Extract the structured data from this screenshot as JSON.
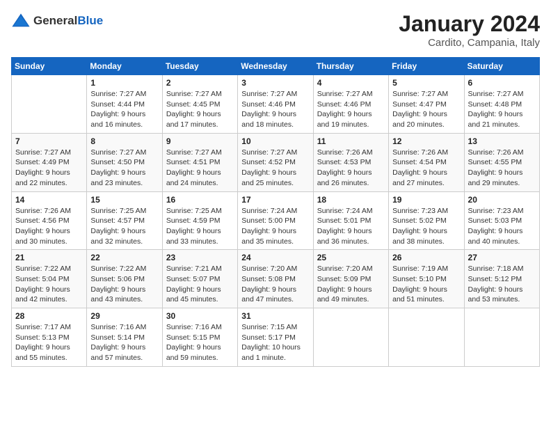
{
  "header": {
    "logo": {
      "general": "General",
      "blue": "Blue",
      "icon_alt": "GeneralBlue logo"
    },
    "title": "January 2024",
    "subtitle": "Cardito, Campania, Italy"
  },
  "days_of_week": [
    "Sunday",
    "Monday",
    "Tuesday",
    "Wednesday",
    "Thursday",
    "Friday",
    "Saturday"
  ],
  "weeks": [
    [
      {
        "date": "",
        "sunrise": "",
        "sunset": "",
        "daylight": ""
      },
      {
        "date": "1",
        "sunrise": "Sunrise: 7:27 AM",
        "sunset": "Sunset: 4:44 PM",
        "daylight": "Daylight: 9 hours and 16 minutes."
      },
      {
        "date": "2",
        "sunrise": "Sunrise: 7:27 AM",
        "sunset": "Sunset: 4:45 PM",
        "daylight": "Daylight: 9 hours and 17 minutes."
      },
      {
        "date": "3",
        "sunrise": "Sunrise: 7:27 AM",
        "sunset": "Sunset: 4:46 PM",
        "daylight": "Daylight: 9 hours and 18 minutes."
      },
      {
        "date": "4",
        "sunrise": "Sunrise: 7:27 AM",
        "sunset": "Sunset: 4:46 PM",
        "daylight": "Daylight: 9 hours and 19 minutes."
      },
      {
        "date": "5",
        "sunrise": "Sunrise: 7:27 AM",
        "sunset": "Sunset: 4:47 PM",
        "daylight": "Daylight: 9 hours and 20 minutes."
      },
      {
        "date": "6",
        "sunrise": "Sunrise: 7:27 AM",
        "sunset": "Sunset: 4:48 PM",
        "daylight": "Daylight: 9 hours and 21 minutes."
      }
    ],
    [
      {
        "date": "7",
        "sunrise": "Sunrise: 7:27 AM",
        "sunset": "Sunset: 4:49 PM",
        "daylight": "Daylight: 9 hours and 22 minutes."
      },
      {
        "date": "8",
        "sunrise": "Sunrise: 7:27 AM",
        "sunset": "Sunset: 4:50 PM",
        "daylight": "Daylight: 9 hours and 23 minutes."
      },
      {
        "date": "9",
        "sunrise": "Sunrise: 7:27 AM",
        "sunset": "Sunset: 4:51 PM",
        "daylight": "Daylight: 9 hours and 24 minutes."
      },
      {
        "date": "10",
        "sunrise": "Sunrise: 7:27 AM",
        "sunset": "Sunset: 4:52 PM",
        "daylight": "Daylight: 9 hours and 25 minutes."
      },
      {
        "date": "11",
        "sunrise": "Sunrise: 7:26 AM",
        "sunset": "Sunset: 4:53 PM",
        "daylight": "Daylight: 9 hours and 26 minutes."
      },
      {
        "date": "12",
        "sunrise": "Sunrise: 7:26 AM",
        "sunset": "Sunset: 4:54 PM",
        "daylight": "Daylight: 9 hours and 27 minutes."
      },
      {
        "date": "13",
        "sunrise": "Sunrise: 7:26 AM",
        "sunset": "Sunset: 4:55 PM",
        "daylight": "Daylight: 9 hours and 29 minutes."
      }
    ],
    [
      {
        "date": "14",
        "sunrise": "Sunrise: 7:26 AM",
        "sunset": "Sunset: 4:56 PM",
        "daylight": "Daylight: 9 hours and 30 minutes."
      },
      {
        "date": "15",
        "sunrise": "Sunrise: 7:25 AM",
        "sunset": "Sunset: 4:57 PM",
        "daylight": "Daylight: 9 hours and 32 minutes."
      },
      {
        "date": "16",
        "sunrise": "Sunrise: 7:25 AM",
        "sunset": "Sunset: 4:59 PM",
        "daylight": "Daylight: 9 hours and 33 minutes."
      },
      {
        "date": "17",
        "sunrise": "Sunrise: 7:24 AM",
        "sunset": "Sunset: 5:00 PM",
        "daylight": "Daylight: 9 hours and 35 minutes."
      },
      {
        "date": "18",
        "sunrise": "Sunrise: 7:24 AM",
        "sunset": "Sunset: 5:01 PM",
        "daylight": "Daylight: 9 hours and 36 minutes."
      },
      {
        "date": "19",
        "sunrise": "Sunrise: 7:23 AM",
        "sunset": "Sunset: 5:02 PM",
        "daylight": "Daylight: 9 hours and 38 minutes."
      },
      {
        "date": "20",
        "sunrise": "Sunrise: 7:23 AM",
        "sunset": "Sunset: 5:03 PM",
        "daylight": "Daylight: 9 hours and 40 minutes."
      }
    ],
    [
      {
        "date": "21",
        "sunrise": "Sunrise: 7:22 AM",
        "sunset": "Sunset: 5:04 PM",
        "daylight": "Daylight: 9 hours and 42 minutes."
      },
      {
        "date": "22",
        "sunrise": "Sunrise: 7:22 AM",
        "sunset": "Sunset: 5:06 PM",
        "daylight": "Daylight: 9 hours and 43 minutes."
      },
      {
        "date": "23",
        "sunrise": "Sunrise: 7:21 AM",
        "sunset": "Sunset: 5:07 PM",
        "daylight": "Daylight: 9 hours and 45 minutes."
      },
      {
        "date": "24",
        "sunrise": "Sunrise: 7:20 AM",
        "sunset": "Sunset: 5:08 PM",
        "daylight": "Daylight: 9 hours and 47 minutes."
      },
      {
        "date": "25",
        "sunrise": "Sunrise: 7:20 AM",
        "sunset": "Sunset: 5:09 PM",
        "daylight": "Daylight: 9 hours and 49 minutes."
      },
      {
        "date": "26",
        "sunrise": "Sunrise: 7:19 AM",
        "sunset": "Sunset: 5:10 PM",
        "daylight": "Daylight: 9 hours and 51 minutes."
      },
      {
        "date": "27",
        "sunrise": "Sunrise: 7:18 AM",
        "sunset": "Sunset: 5:12 PM",
        "daylight": "Daylight: 9 hours and 53 minutes."
      }
    ],
    [
      {
        "date": "28",
        "sunrise": "Sunrise: 7:17 AM",
        "sunset": "Sunset: 5:13 PM",
        "daylight": "Daylight: 9 hours and 55 minutes."
      },
      {
        "date": "29",
        "sunrise": "Sunrise: 7:16 AM",
        "sunset": "Sunset: 5:14 PM",
        "daylight": "Daylight: 9 hours and 57 minutes."
      },
      {
        "date": "30",
        "sunrise": "Sunrise: 7:16 AM",
        "sunset": "Sunset: 5:15 PM",
        "daylight": "Daylight: 9 hours and 59 minutes."
      },
      {
        "date": "31",
        "sunrise": "Sunrise: 7:15 AM",
        "sunset": "Sunset: 5:17 PM",
        "daylight": "Daylight: 10 hours and 1 minute."
      },
      {
        "date": "",
        "sunrise": "",
        "sunset": "",
        "daylight": ""
      },
      {
        "date": "",
        "sunrise": "",
        "sunset": "",
        "daylight": ""
      },
      {
        "date": "",
        "sunrise": "",
        "sunset": "",
        "daylight": ""
      }
    ]
  ]
}
